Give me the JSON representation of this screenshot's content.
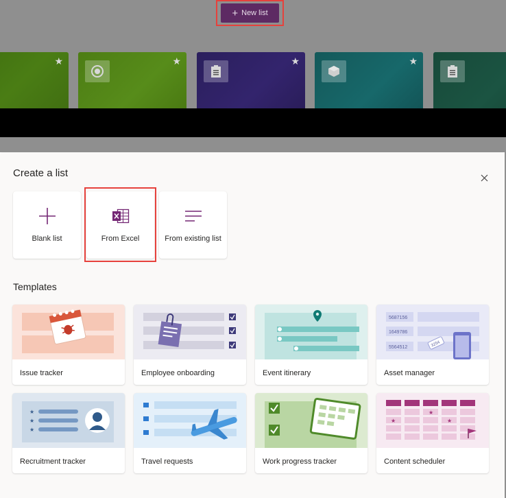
{
  "toolbar": {
    "new_list_label": "New list"
  },
  "dialog": {
    "title": "Create a list",
    "close_icon": "close-icon",
    "options": [
      {
        "label": "Blank list",
        "icon": "plus-icon"
      },
      {
        "label": "From Excel",
        "icon": "excel-icon"
      },
      {
        "label": "From existing list",
        "icon": "list-lines-icon"
      }
    ],
    "templates_heading": "Templates",
    "templates": [
      {
        "label": "Issue tracker"
      },
      {
        "label": "Employee onboarding"
      },
      {
        "label": "Event itinerary"
      },
      {
        "label": "Asset manager",
        "thumb_numbers": [
          "5687156",
          "1649786",
          "5564512",
          "3254"
        ]
      },
      {
        "label": "Recruitment tracker"
      },
      {
        "label": "Travel requests"
      },
      {
        "label": "Work progress tracker"
      },
      {
        "label": "Content scheduler"
      }
    ]
  },
  "colors": {
    "accent": "#742774",
    "highlight": "#e6413c",
    "button_bg": "#5d2a63"
  }
}
